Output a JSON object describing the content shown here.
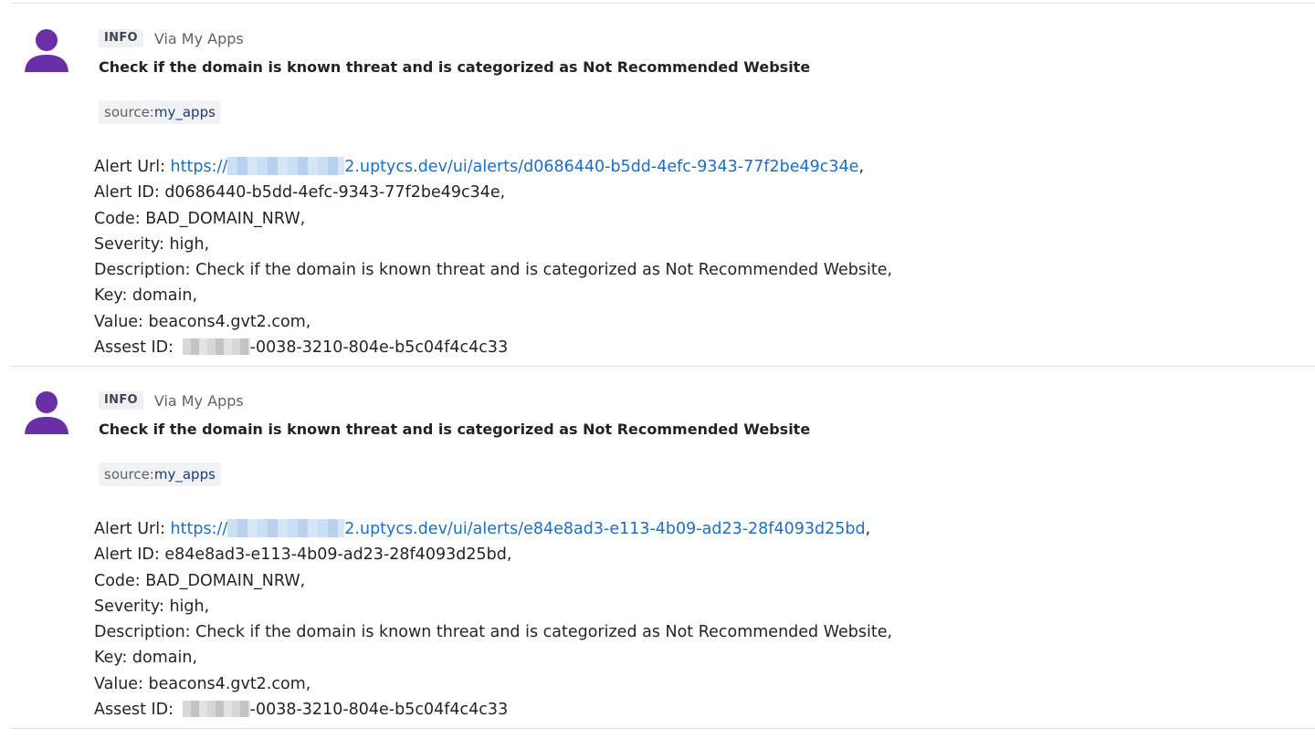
{
  "events": [
    {
      "level": "INFO",
      "via": "Via My Apps",
      "title": "Check if the domain is known threat and is categorized as Not Recommended Website",
      "tag": {
        "key": "source:",
        "value": "my_apps"
      },
      "alert_url": {
        "label": "Alert Url: ",
        "link_prefix": "https://",
        "link_suffix": "2.uptycs.dev/ui/alerts/d0686440-b5dd-4efc-9343-77f2be49c34e",
        "trailing": ","
      },
      "alert_id": "Alert ID: d0686440-b5dd-4efc-9343-77f2be49c34e,",
      "code": "Code: BAD_DOMAIN_NRW,",
      "severity": "Severity: high,",
      "description": "Description: Check if the domain is known threat and is categorized as Not Recommended Website,",
      "key": "Key: domain,",
      "value": "Value: beacons4.gvt2.com,",
      "asset_id": {
        "label": "Assest ID: ",
        "suffix": "-0038-3210-804e-b5c04f4c4c33"
      }
    },
    {
      "level": "INFO",
      "via": "Via My Apps",
      "title": "Check if the domain is known threat and is categorized as Not Recommended Website",
      "tag": {
        "key": "source:",
        "value": "my_apps"
      },
      "alert_url": {
        "label": "Alert Url: ",
        "link_prefix": "https://",
        "link_suffix": "2.uptycs.dev/ui/alerts/e84e8ad3-e113-4b09-ad23-28f4093d25bd",
        "trailing": ","
      },
      "alert_id": "Alert ID: e84e8ad3-e113-4b09-ad23-28f4093d25bd,",
      "code": "Code: BAD_DOMAIN_NRW,",
      "severity": "Severity: high,",
      "description": "Description: Check if the domain is known threat and is categorized as Not Recommended Website,",
      "key": "Key: domain,",
      "value": "Value: beacons4.gvt2.com,",
      "asset_id": {
        "label": "Assest ID: ",
        "suffix": "-0038-3210-804e-b5c04f4c4c33"
      }
    }
  ],
  "colors": {
    "avatar": "#6a2fa6",
    "link": "#1a6fc4",
    "tag_value": "#1d3a77"
  },
  "icons": {
    "avatar": "person-silhouette-icon"
  }
}
